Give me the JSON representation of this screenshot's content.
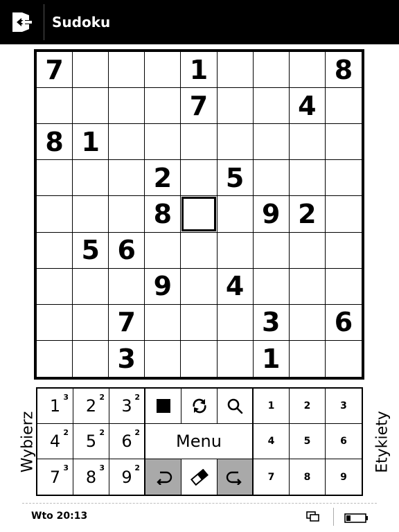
{
  "app": {
    "title": "Sudoku"
  },
  "board": {
    "rows": [
      [
        "7",
        "",
        "",
        "",
        "1",
        "",
        "",
        "",
        "8"
      ],
      [
        "",
        "",
        "",
        "",
        "7",
        "",
        "",
        "4",
        ""
      ],
      [
        "8",
        "1",
        "",
        "",
        "",
        "",
        "",
        "",
        ""
      ],
      [
        "",
        "",
        "",
        "2",
        "",
        "5",
        "",
        "",
        ""
      ],
      [
        "",
        "",
        "",
        "8",
        "",
        "",
        "9",
        "2",
        ""
      ],
      [
        "",
        "5",
        "6",
        "",
        "",
        "",
        "",
        "",
        ""
      ],
      [
        "",
        "",
        "",
        "9",
        "",
        "4",
        "",
        "",
        ""
      ],
      [
        "",
        "",
        "7",
        "",
        "",
        "",
        "3",
        "",
        "6"
      ],
      [
        "",
        "",
        "3",
        "",
        "",
        "",
        "1",
        "",
        ""
      ]
    ],
    "selected": {
      "row": 4,
      "col": 4
    }
  },
  "labels": {
    "left": "Wybierz",
    "right": "Etykiety"
  },
  "keypad": {
    "digits": [
      {
        "digit": "1",
        "count": "3"
      },
      {
        "digit": "2",
        "count": "2"
      },
      {
        "digit": "3",
        "count": "2"
      },
      {
        "digit": "4",
        "count": "2"
      },
      {
        "digit": "5",
        "count": "2"
      },
      {
        "digit": "6",
        "count": "2"
      },
      {
        "digit": "7",
        "count": "3"
      },
      {
        "digit": "8",
        "count": "3"
      },
      {
        "digit": "9",
        "count": "2"
      }
    ],
    "menu_label": "Menu",
    "tags": [
      "1",
      "2",
      "3",
      "4",
      "5",
      "6",
      "7",
      "8",
      "9"
    ],
    "icons": {
      "fill": "filled-square-icon",
      "refresh": "refresh-icon",
      "search": "magnifier-icon",
      "undo": "undo-icon",
      "erase": "eraser-icon",
      "redo": "redo-icon",
      "exit": "exit-door-icon"
    },
    "active_button_color": "#a9a9a9"
  },
  "status": {
    "clock": "Wto 20:13"
  }
}
